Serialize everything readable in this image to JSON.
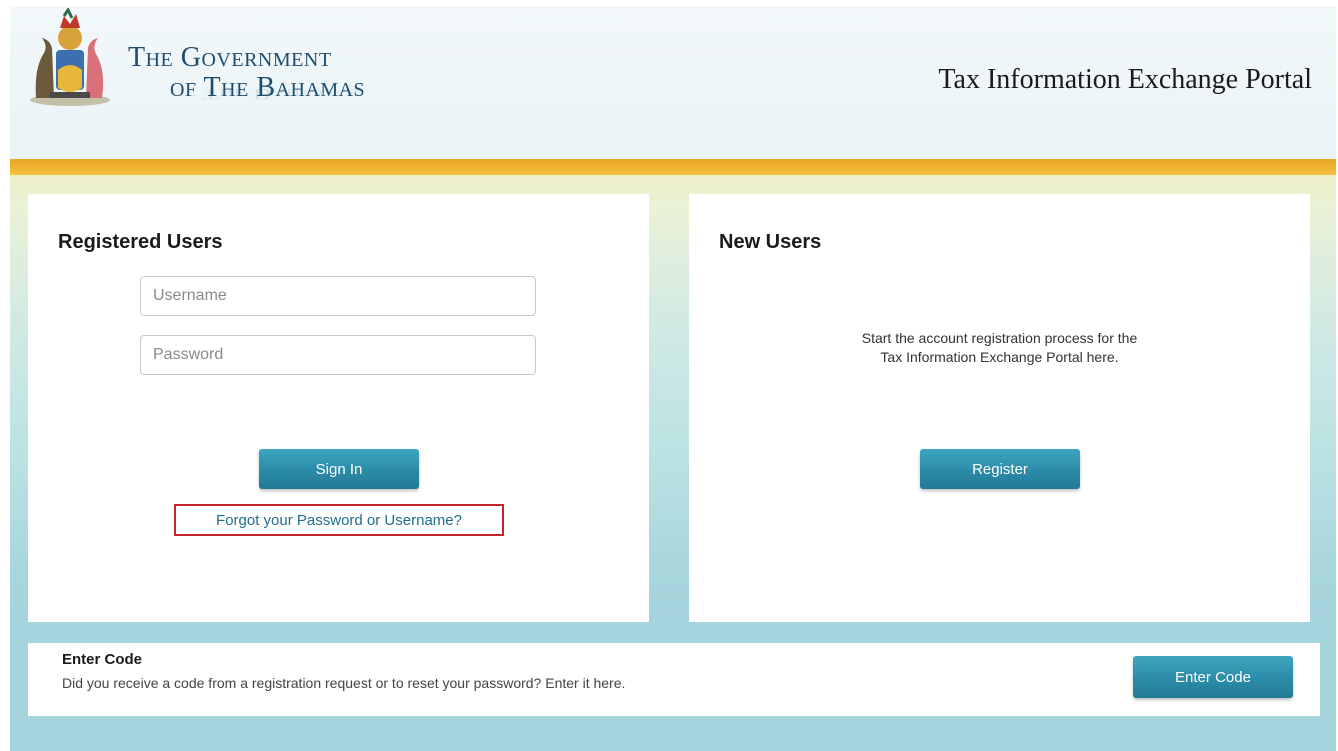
{
  "header": {
    "gov_line1": "The Government",
    "gov_line2": "of The Bahamas",
    "portal_title": "Tax Information Exchange Portal",
    "crest_icon": "bahamas-coat-of-arms-icon"
  },
  "registered": {
    "title": "Registered Users",
    "username_placeholder": "Username",
    "password_placeholder": "Password",
    "signin_label": "Sign In",
    "forgot_label": "Forgot your Password or Username?"
  },
  "new_users": {
    "title": "New Users",
    "description_line1": "Start the account registration process for the",
    "description_line2": "Tax Information Exchange Portal here.",
    "register_label": "Register"
  },
  "code": {
    "title": "Enter Code",
    "description": "Did you receive a code from a registration request or to reset your password? Enter it here.",
    "button_label": "Enter Code"
  },
  "colors": {
    "button": "#2b8ca8",
    "highlight_border": "#c9212a",
    "header_band": "#f1b534",
    "brand_text": "#1e4d6f"
  }
}
